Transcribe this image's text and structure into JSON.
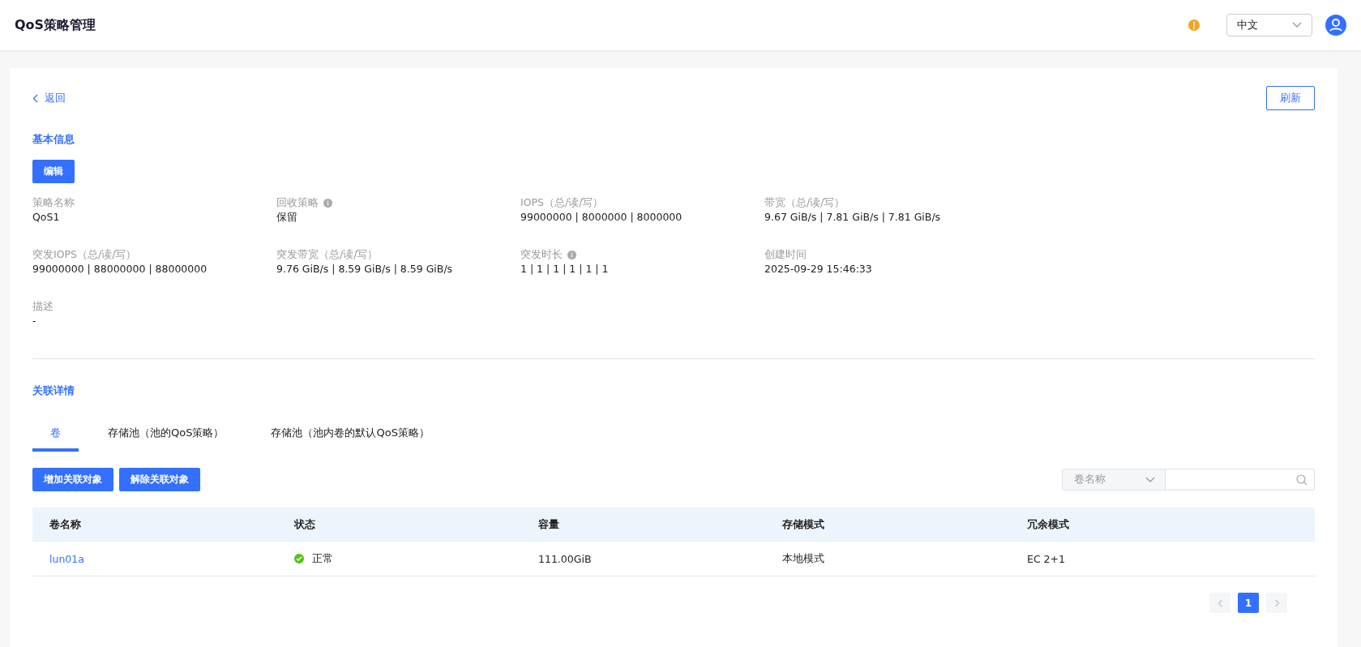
{
  "header": {
    "title": "QoS策略管理",
    "language": "中文"
  },
  "back": "返回",
  "refresh": "刷新",
  "basic": {
    "title": "基本信息",
    "edit": "编辑",
    "fields": [
      {
        "label": "策略名称",
        "value": "QoS1",
        "info": false
      },
      {
        "label": "回收策略",
        "value": "保留",
        "info": true
      },
      {
        "label": "IOPS（总/读/写）",
        "value": "99000000 | 8000000 | 8000000",
        "info": false
      },
      {
        "label": "带宽（总/读/写）",
        "value": "9.67 GiB/s | 7.81 GiB/s | 7.81 GiB/s",
        "info": false
      },
      {
        "label": "突发IOPS（总/读/写）",
        "value": "99000000 | 88000000 | 88000000",
        "info": false
      },
      {
        "label": "突发带宽（总/读/写）",
        "value": "9.76 GiB/s | 8.59 GiB/s | 8.59 GiB/s",
        "info": false
      },
      {
        "label": "突发时长",
        "value": "1 | 1 | 1 | 1 | 1 | 1",
        "info": true
      },
      {
        "label": "创建时间",
        "value": "2025-09-29 15:46:33",
        "info": false
      },
      {
        "label": "描述",
        "value": "-",
        "info": false
      }
    ]
  },
  "related": {
    "title": "关联详情",
    "tabs": [
      {
        "label": "卷",
        "selected": true
      },
      {
        "label": "存储池（池的QoS策略）",
        "selected": false
      },
      {
        "label": "存储池（池内卷的默认QoS策略）",
        "selected": false
      }
    ],
    "buttons": [
      "增加关联对象",
      "解除关联对象"
    ],
    "search": {
      "field": "卷名称"
    },
    "table": {
      "columns": [
        "卷名称",
        "状态",
        "容量",
        "存储模式",
        "冗余模式"
      ],
      "rows": [
        {
          "name": "lun01a",
          "status": "正常",
          "color": "#52c41a",
          "capacity": "111.00GiB",
          "storage_mode": "本地模式",
          "redundancy": "EC 2+1"
        }
      ]
    },
    "pagination": {
      "prev_disabled": true,
      "next_disabled": true,
      "pages": [
        {
          "label": "1",
          "selected": true
        }
      ]
    }
  }
}
